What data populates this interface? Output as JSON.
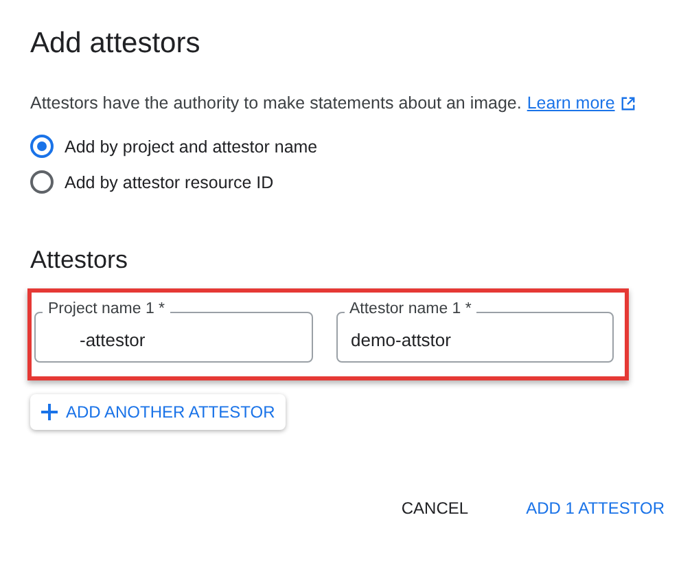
{
  "dialog": {
    "title": "Add attestors",
    "description": "Attestors have the authority to make statements about an image.",
    "learn_more": "Learn more"
  },
  "options": [
    {
      "label": "Add by project and attestor name",
      "selected": true
    },
    {
      "label": "Add by attestor resource ID",
      "selected": false
    }
  ],
  "attestors": {
    "heading": "Attestors",
    "highlighted": true,
    "fields": [
      {
        "label": "Project name 1 *",
        "value": "-attestor"
      },
      {
        "label": "Attestor name 1 *",
        "value": "demo-attstor"
      }
    ],
    "add_button": "ADD ANOTHER ATTESTOR"
  },
  "buttons": [
    {
      "label": "CANCEL",
      "kind": "secondary"
    },
    {
      "label": "ADD 1 ATTESTOR",
      "kind": "primary"
    }
  ]
}
